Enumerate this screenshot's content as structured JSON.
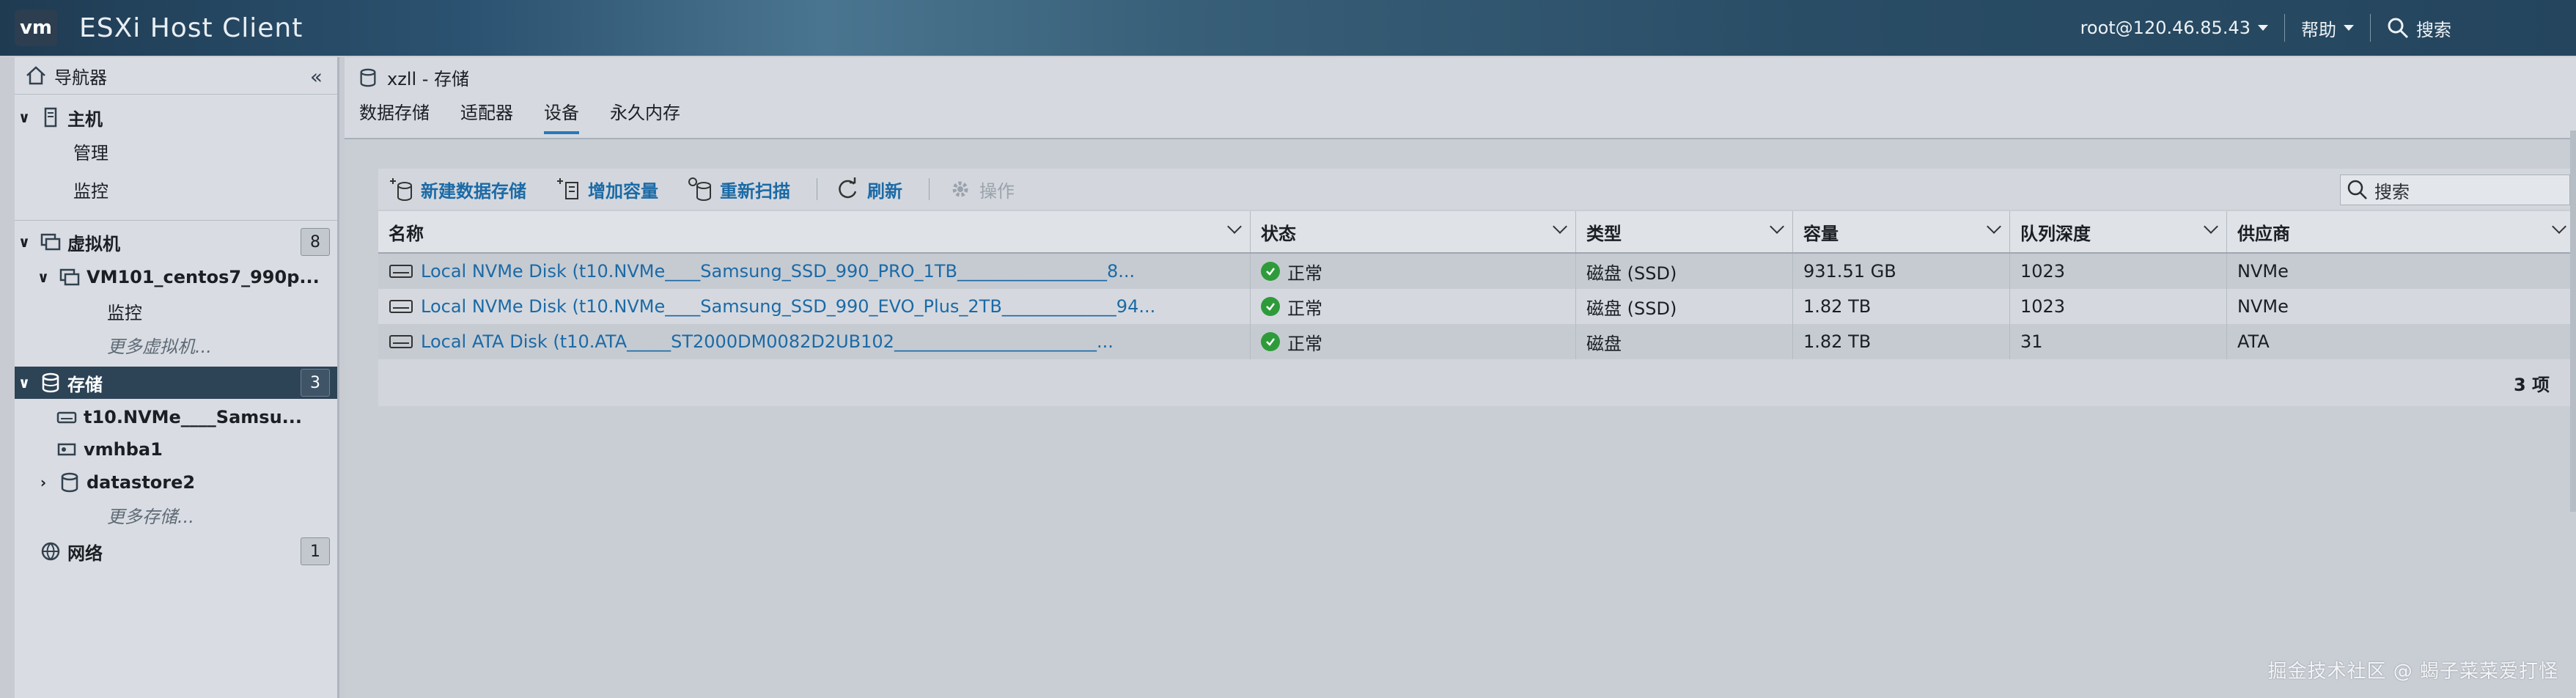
{
  "header": {
    "logo": "vm",
    "app_title": "ESXi Host Client",
    "user": "root@120.46.85.43",
    "help": "帮助",
    "search": "搜索"
  },
  "sidebar": {
    "title": "导航器",
    "host": "主机",
    "host_manage": "管理",
    "host_monitor": "监控",
    "vms": "虚拟机",
    "vms_count": "8",
    "vm_name": "VM101_centos7_990p...",
    "vm_monitor": "监控",
    "vm_more": "更多虚拟机...",
    "storage": "存储",
    "storage_count": "3",
    "storage_items": [
      "t10.NVMe____Samsu...",
      "vmhba1",
      "datastore2"
    ],
    "storage_more": "更多存储...",
    "network": "网络",
    "network_count": "1"
  },
  "main": {
    "breadcrumb": "xzll - 存储",
    "tabs": [
      "数据存储",
      "适配器",
      "设备",
      "永久内存"
    ],
    "active_tab": "设备"
  },
  "toolbar": {
    "new_datastore": "新建数据存储",
    "increase_capacity": "增加容量",
    "rescan": "重新扫描",
    "refresh": "刷新",
    "actions": "操作",
    "search_placeholder": "搜索"
  },
  "table": {
    "columns": [
      "名称",
      "状态",
      "类型",
      "容量",
      "队列深度",
      "供应商"
    ],
    "rows": [
      {
        "name": "Local NVMe Disk (t10.NVMe____Samsung_SSD_990_PRO_1TB_________________8...",
        "status": "正常",
        "type": "磁盘 (SSD)",
        "capacity": "931.51 GB",
        "queue": "1023",
        "vendor": "NVMe"
      },
      {
        "name": "Local NVMe Disk (t10.NVMe____Samsung_SSD_990_EVO_Plus_2TB_____________94...",
        "status": "正常",
        "type": "磁盘 (SSD)",
        "capacity": "1.82 TB",
        "queue": "1023",
        "vendor": "NVMe"
      },
      {
        "name": "Local ATA Disk (t10.ATA_____ST2000DM0082D2UB102_______________________...",
        "status": "正常",
        "type": "磁盘",
        "capacity": "1.82 TB",
        "queue": "31",
        "vendor": "ATA"
      }
    ],
    "footer": "3 项"
  },
  "watermark": "掘金技术社区 @ 蝎子菜菜爱打怪",
  "colors": {
    "accent": "#1b6aa6",
    "ok": "#2e9b3a",
    "selected_nav": "#2d4356"
  }
}
